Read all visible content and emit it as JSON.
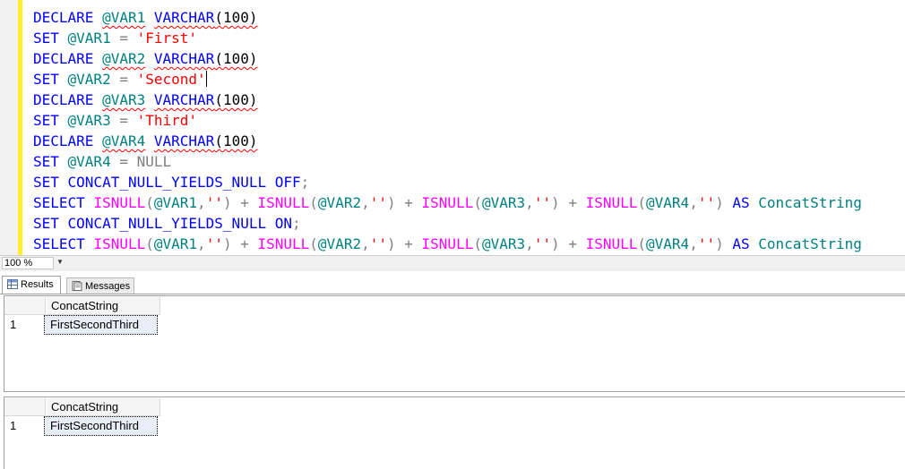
{
  "editor": {
    "lines": [
      [
        {
          "t": "DECLARE ",
          "c": "kw"
        },
        {
          "t": "@VAR1",
          "c": "var squig"
        },
        {
          "t": " ",
          "c": ""
        },
        {
          "t": "VARCHAR",
          "c": "kw squig"
        },
        {
          "t": "(100)",
          "c": "squig"
        }
      ],
      [
        {
          "t": "SET ",
          "c": "kw"
        },
        {
          "t": "@VAR1",
          "c": "var"
        },
        {
          "t": " = ",
          "c": "gray"
        },
        {
          "t": "'First'",
          "c": "str"
        }
      ],
      [
        {
          "t": "DECLARE ",
          "c": "kw"
        },
        {
          "t": "@VAR2",
          "c": "var squig"
        },
        {
          "t": " ",
          "c": ""
        },
        {
          "t": "VARCHAR",
          "c": "kw squig"
        },
        {
          "t": "(100)",
          "c": "squig"
        }
      ],
      [
        {
          "t": "SET ",
          "c": "kw"
        },
        {
          "t": "@VAR2",
          "c": "var"
        },
        {
          "t": " = ",
          "c": "gray"
        },
        {
          "t": "'Second'",
          "c": "str"
        },
        {
          "t": "",
          "c": "caret"
        }
      ],
      [
        {
          "t": "DECLARE ",
          "c": "kw"
        },
        {
          "t": "@VAR3",
          "c": "var squig"
        },
        {
          "t": " ",
          "c": ""
        },
        {
          "t": "VARCHAR",
          "c": "kw squig"
        },
        {
          "t": "(100)",
          "c": "squig"
        }
      ],
      [
        {
          "t": "SET ",
          "c": "kw"
        },
        {
          "t": "@VAR3",
          "c": "var"
        },
        {
          "t": " = ",
          "c": "gray"
        },
        {
          "t": "'Third'",
          "c": "str"
        }
      ],
      [
        {
          "t": "DECLARE ",
          "c": "kw"
        },
        {
          "t": "@VAR4",
          "c": "var squig"
        },
        {
          "t": " ",
          "c": ""
        },
        {
          "t": "VARCHAR",
          "c": "kw squig"
        },
        {
          "t": "(100)",
          "c": "squig"
        }
      ],
      [
        {
          "t": "SET ",
          "c": "kw"
        },
        {
          "t": "@VAR4",
          "c": "var"
        },
        {
          "t": " = ",
          "c": "gray"
        },
        {
          "t": "NULL",
          "c": "gray"
        }
      ],
      [
        {
          "t": "SET ",
          "c": "kw"
        },
        {
          "t": "CONCAT_NULL_YIELDS_NULL",
          "c": "kw"
        },
        {
          "t": " ",
          "c": ""
        },
        {
          "t": "OFF",
          "c": "kw"
        },
        {
          "t": ";",
          "c": "gray"
        }
      ],
      [
        {
          "t": "SELECT ",
          "c": "kw"
        },
        {
          "t": "ISNULL",
          "c": "fn"
        },
        {
          "t": "(",
          "c": "gray"
        },
        {
          "t": "@VAR1",
          "c": "var"
        },
        {
          "t": ",",
          "c": "gray"
        },
        {
          "t": "''",
          "c": "str"
        },
        {
          "t": ") + ",
          "c": "gray"
        },
        {
          "t": "ISNULL",
          "c": "fn"
        },
        {
          "t": "(",
          "c": "gray"
        },
        {
          "t": "@VAR2",
          "c": "var"
        },
        {
          "t": ",",
          "c": "gray"
        },
        {
          "t": "''",
          "c": "str"
        },
        {
          "t": ") + ",
          "c": "gray"
        },
        {
          "t": "ISNULL",
          "c": "fn"
        },
        {
          "t": "(",
          "c": "gray"
        },
        {
          "t": "@VAR3",
          "c": "var"
        },
        {
          "t": ",",
          "c": "gray"
        },
        {
          "t": "''",
          "c": "str"
        },
        {
          "t": ") + ",
          "c": "gray"
        },
        {
          "t": "ISNULL",
          "c": "fn"
        },
        {
          "t": "(",
          "c": "gray"
        },
        {
          "t": "@VAR4",
          "c": "var"
        },
        {
          "t": ",",
          "c": "gray"
        },
        {
          "t": "''",
          "c": "str"
        },
        {
          "t": ") ",
          "c": "gray"
        },
        {
          "t": "AS ",
          "c": "kw"
        },
        {
          "t": "ConcatString",
          "c": "var"
        }
      ],
      [
        {
          "t": "SET ",
          "c": "kw"
        },
        {
          "t": "CONCAT_NULL_YIELDS_NULL",
          "c": "kw"
        },
        {
          "t": " ",
          "c": ""
        },
        {
          "t": "ON",
          "c": "kw"
        },
        {
          "t": ";",
          "c": "gray"
        }
      ],
      [
        {
          "t": "SELECT ",
          "c": "kw"
        },
        {
          "t": "ISNULL",
          "c": "fn"
        },
        {
          "t": "(",
          "c": "gray"
        },
        {
          "t": "@VAR1",
          "c": "var"
        },
        {
          "t": ",",
          "c": "gray"
        },
        {
          "t": "''",
          "c": "str"
        },
        {
          "t": ") + ",
          "c": "gray"
        },
        {
          "t": "ISNULL",
          "c": "fn"
        },
        {
          "t": "(",
          "c": "gray"
        },
        {
          "t": "@VAR2",
          "c": "var"
        },
        {
          "t": ",",
          "c": "gray"
        },
        {
          "t": "''",
          "c": "str"
        },
        {
          "t": ") + ",
          "c": "gray"
        },
        {
          "t": "ISNULL",
          "c": "fn"
        },
        {
          "t": "(",
          "c": "gray"
        },
        {
          "t": "@VAR3",
          "c": "var"
        },
        {
          "t": ",",
          "c": "gray"
        },
        {
          "t": "''",
          "c": "str"
        },
        {
          "t": ") + ",
          "c": "gray"
        },
        {
          "t": "ISNULL",
          "c": "fn"
        },
        {
          "t": "(",
          "c": "gray"
        },
        {
          "t": "@VAR4",
          "c": "var"
        },
        {
          "t": ",",
          "c": "gray"
        },
        {
          "t": "''",
          "c": "str"
        },
        {
          "t": ") ",
          "c": "gray"
        },
        {
          "t": "AS ",
          "c": "kw"
        },
        {
          "t": "ConcatString",
          "c": "var"
        }
      ]
    ]
  },
  "statusbar": {
    "zoom": "100 %"
  },
  "tabs": {
    "results": "Results",
    "messages": "Messages"
  },
  "results": [
    {
      "column": "ConcatString",
      "row_number": "1",
      "value": "FirstSecondThird"
    },
    {
      "column": "ConcatString",
      "row_number": "1",
      "value": "FirstSecondThird"
    }
  ],
  "colors": {
    "keyword": "#0000ff",
    "function": "#ff00ff",
    "string": "#ff0000",
    "variable": "#008080",
    "operator": "#808080"
  }
}
